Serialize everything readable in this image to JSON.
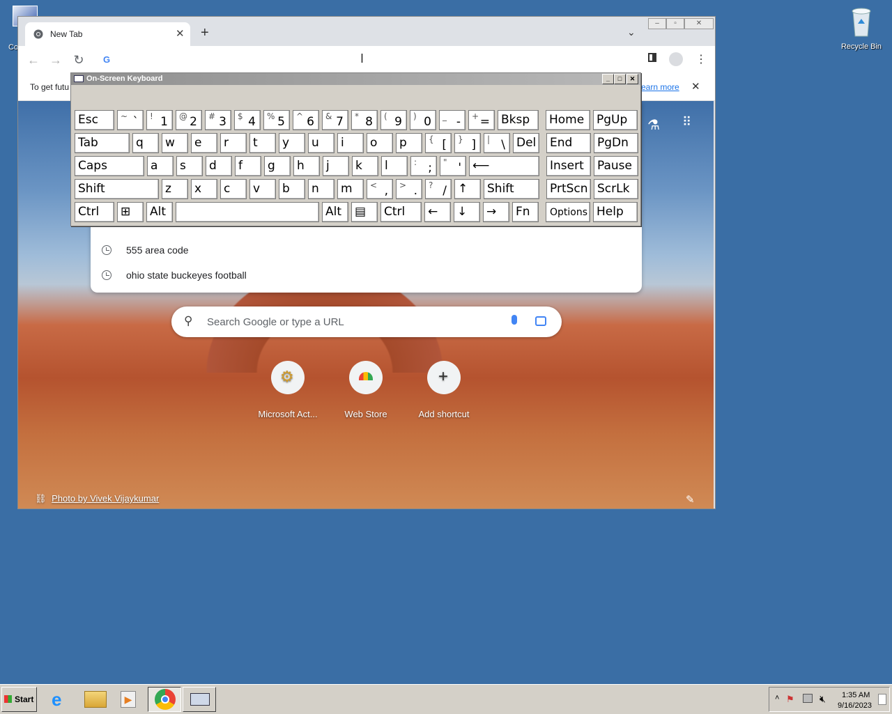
{
  "desktop": {
    "left_icon_label": "Co",
    "recycle_bin_label": "Recycle Bin"
  },
  "browser": {
    "tab_title": "New Tab",
    "infobar_text": "To get futu",
    "infobar_link": "earn more",
    "suggestions": [
      "555 area code",
      "ohio state buckeyes football"
    ],
    "search_placeholder": "Search Google or type a URL",
    "shortcuts": [
      {
        "label": "Microsoft Act...",
        "icon": "gear-key-icon"
      },
      {
        "label": "Web Store",
        "icon": "web-store-icon"
      },
      {
        "label": "Add shortcut",
        "icon": "plus-icon"
      }
    ],
    "photo_credit": "Photo by Vivek Vijaykumar"
  },
  "osk": {
    "title": "On-Screen Keyboard",
    "rows": [
      [
        {
          "m": "Esc",
          "w": 57
        },
        {
          "s": "~",
          "b": "`",
          "w": 38
        },
        {
          "s": "!",
          "b": "1",
          "w": 38
        },
        {
          "s": "@",
          "b": "2",
          "w": 38
        },
        {
          "s": "#",
          "b": "3",
          "w": 38
        },
        {
          "s": "$",
          "b": "4",
          "w": 38
        },
        {
          "s": "%",
          "b": "5",
          "w": 38
        },
        {
          "s": "^",
          "b": "6",
          "w": 38
        },
        {
          "s": "&",
          "b": "7",
          "w": 38
        },
        {
          "s": "*",
          "b": "8",
          "w": 38
        },
        {
          "s": "(",
          "b": "9",
          "w": 38
        },
        {
          "s": ")",
          "b": "0",
          "w": 38
        },
        {
          "s": "_",
          "b": "-",
          "w": 38
        },
        {
          "s": "+",
          "b": "=",
          "w": 38
        },
        {
          "m": "Bksp",
          "w": 59
        },
        {
          "m": "Home",
          "w": 64,
          "gap": 6
        },
        {
          "m": "PgUp",
          "w": 64
        }
      ],
      [
        {
          "m": "Tab",
          "w": 79
        },
        {
          "m": "q",
          "w": 38
        },
        {
          "m": "w",
          "w": 38
        },
        {
          "m": "e",
          "w": 38
        },
        {
          "m": "r",
          "w": 38
        },
        {
          "m": "t",
          "w": 38
        },
        {
          "m": "y",
          "w": 38
        },
        {
          "m": "u",
          "w": 38
        },
        {
          "m": "i",
          "w": 38
        },
        {
          "m": "o",
          "w": 38
        },
        {
          "m": "p",
          "w": 38
        },
        {
          "s": "{",
          "b": "[",
          "w": 38
        },
        {
          "s": "}",
          "b": "]",
          "w": 38
        },
        {
          "s": "|",
          "b": "\\",
          "w": 38
        },
        {
          "m": "Del",
          "w": 38
        },
        {
          "m": "End",
          "w": 64,
          "gap": 6
        },
        {
          "m": "PgDn",
          "w": 64
        }
      ],
      [
        {
          "m": "Caps",
          "w": 100
        },
        {
          "m": "a",
          "w": 38
        },
        {
          "m": "s",
          "w": 38
        },
        {
          "m": "d",
          "w": 38
        },
        {
          "m": "f",
          "w": 38
        },
        {
          "m": "g",
          "w": 38
        },
        {
          "m": "h",
          "w": 38
        },
        {
          "m": "j",
          "w": 38
        },
        {
          "m": "k",
          "w": 38
        },
        {
          "m": "l",
          "w": 38
        },
        {
          "s": ":",
          "b": ";",
          "w": 38
        },
        {
          "s": "\"",
          "b": "'",
          "w": 38
        },
        {
          "m": "⟵",
          "w": 101
        },
        {
          "m": "Insert",
          "w": 64,
          "gap": 6
        },
        {
          "m": "Pause",
          "w": 64
        }
      ],
      [
        {
          "m": "Shift",
          "w": 121
        },
        {
          "m": "z",
          "w": 38
        },
        {
          "m": "x",
          "w": 38
        },
        {
          "m": "c",
          "w": 38
        },
        {
          "m": "v",
          "w": 38
        },
        {
          "m": "b",
          "w": 38
        },
        {
          "m": "n",
          "w": 38
        },
        {
          "m": "m",
          "w": 38
        },
        {
          "s": "<",
          "b": ",",
          "w": 38
        },
        {
          "s": ">",
          "b": ".",
          "w": 38
        },
        {
          "s": "?",
          "b": "/",
          "w": 38
        },
        {
          "m": "↑",
          "w": 38
        },
        {
          "m": "Shift",
          "w": 80
        },
        {
          "m": "PrtScn",
          "w": 64,
          "gap": 6
        },
        {
          "m": "ScrLk",
          "w": 64
        }
      ],
      [
        {
          "m": "Ctrl",
          "w": 57
        },
        {
          "m": "⊞",
          "w": 38
        },
        {
          "m": "Alt",
          "w": 38
        },
        {
          "m": "",
          "w": 206
        },
        {
          "m": "Alt",
          "w": 38
        },
        {
          "m": "▤",
          "w": 38
        },
        {
          "m": "Ctrl",
          "w": 59
        },
        {
          "m": "←",
          "w": 38
        },
        {
          "m": "↓",
          "w": 38
        },
        {
          "m": "→",
          "w": 38
        },
        {
          "m": "Fn",
          "w": 38
        },
        {
          "sm": "Options",
          "w": 64,
          "gap": 6
        },
        {
          "m": "Help",
          "w": 64
        }
      ]
    ]
  },
  "taskbar": {
    "start_label": "Start",
    "time": "1:35 AM",
    "date": "9/16/2023"
  }
}
